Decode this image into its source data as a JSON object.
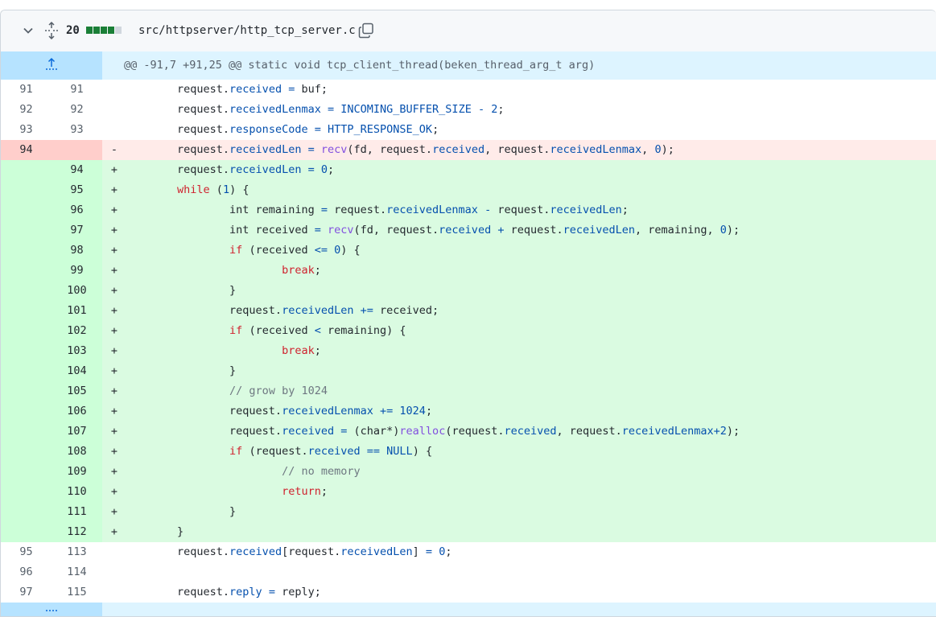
{
  "file": {
    "additions_count": "20",
    "path": "src/httpserver/http_tcp_server.c",
    "diffstat_colors": [
      "#1a7f37",
      "#1a7f37",
      "#1a7f37",
      "#1a7f37",
      "#d0d7de"
    ]
  },
  "hunk": {
    "header": "@@ -91,7 +91,25 @@ static void tcp_client_thread(beken_thread_arg_t arg)"
  },
  "lines": [
    {
      "type": "ctx",
      "old": "91",
      "new": "91",
      "sign": "",
      "code": "\t\trequest.received = buf;"
    },
    {
      "type": "ctx",
      "old": "92",
      "new": "92",
      "sign": "",
      "code": "\t\trequest.receivedLenmax = INCOMING_BUFFER_SIZE - 2;"
    },
    {
      "type": "ctx",
      "old": "93",
      "new": "93",
      "sign": "",
      "code": "\t\trequest.responseCode = HTTP_RESPONSE_OK;"
    },
    {
      "type": "del",
      "old": "94",
      "new": "",
      "sign": "-",
      "code": "\t\trequest.receivedLen = recv(fd, request.received, request.receivedLenmax, 0);"
    },
    {
      "type": "add",
      "old": "",
      "new": "94",
      "sign": "+",
      "code": "\t\trequest.receivedLen = 0;"
    },
    {
      "type": "add",
      "old": "",
      "new": "95",
      "sign": "+",
      "code": "\t\twhile (1) {"
    },
    {
      "type": "add",
      "old": "",
      "new": "96",
      "sign": "+",
      "code": "\t\t\tint remaining = request.receivedLenmax - request.receivedLen;"
    },
    {
      "type": "add",
      "old": "",
      "new": "97",
      "sign": "+",
      "code": "\t\t\tint received = recv(fd, request.received + request.receivedLen, remaining, 0);"
    },
    {
      "type": "add",
      "old": "",
      "new": "98",
      "sign": "+",
      "code": "\t\t\tif (received <= 0) {"
    },
    {
      "type": "add",
      "old": "",
      "new": "99",
      "sign": "+",
      "code": "\t\t\t\tbreak;"
    },
    {
      "type": "add",
      "old": "",
      "new": "100",
      "sign": "+",
      "code": "\t\t\t}"
    },
    {
      "type": "add",
      "old": "",
      "new": "101",
      "sign": "+",
      "code": "\t\t\trequest.receivedLen += received;"
    },
    {
      "type": "add",
      "old": "",
      "new": "102",
      "sign": "+",
      "code": "\t\t\tif (received < remaining) {"
    },
    {
      "type": "add",
      "old": "",
      "new": "103",
      "sign": "+",
      "code": "\t\t\t\tbreak;"
    },
    {
      "type": "add",
      "old": "",
      "new": "104",
      "sign": "+",
      "code": "\t\t\t}"
    },
    {
      "type": "add",
      "old": "",
      "new": "105",
      "sign": "+",
      "code": "\t\t\t// grow by 1024"
    },
    {
      "type": "add",
      "old": "",
      "new": "106",
      "sign": "+",
      "code": "\t\t\trequest.receivedLenmax += 1024;"
    },
    {
      "type": "add",
      "old": "",
      "new": "107",
      "sign": "+",
      "code": "\t\t\trequest.received = (char*)realloc(request.received, request.receivedLenmax+2);"
    },
    {
      "type": "add",
      "old": "",
      "new": "108",
      "sign": "+",
      "code": "\t\t\tif (request.received == NULL) {"
    },
    {
      "type": "add",
      "old": "",
      "new": "109",
      "sign": "+",
      "code": "\t\t\t\t// no memory"
    },
    {
      "type": "add",
      "old": "",
      "new": "110",
      "sign": "+",
      "code": "\t\t\t\treturn;"
    },
    {
      "type": "add",
      "old": "",
      "new": "111",
      "sign": "+",
      "code": "\t\t\t}"
    },
    {
      "type": "add",
      "old": "",
      "new": "112",
      "sign": "+",
      "code": "\t\t}"
    },
    {
      "type": "ctx",
      "old": "95",
      "new": "113",
      "sign": "",
      "code": "\t\trequest.received[request.receivedLen] = 0;"
    },
    {
      "type": "ctx",
      "old": "96",
      "new": "114",
      "sign": "",
      "code": ""
    },
    {
      "type": "ctx",
      "old": "97",
      "new": "115",
      "sign": "",
      "code": "\t\trequest.reply = reply;"
    }
  ]
}
